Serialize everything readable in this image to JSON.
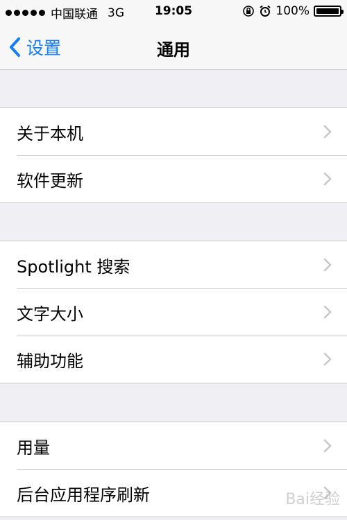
{
  "status_bar": {
    "carrier": "中国联通",
    "network": "3G",
    "time": "19:05",
    "battery": "100%",
    "battery_level": 1.0
  },
  "nav": {
    "back_label": "设置",
    "title": "通用"
  },
  "sections": [
    {
      "items": [
        "关于本机",
        "软件更新"
      ]
    },
    {
      "items": [
        "Spotlight 搜索",
        "文字大小",
        "辅助功能"
      ]
    },
    {
      "items": [
        "用量",
        "后台应用程序刷新"
      ]
    }
  ],
  "colors": {
    "accent": "#147efb",
    "background": "#efeff4"
  },
  "watermark": "Bai经验"
}
